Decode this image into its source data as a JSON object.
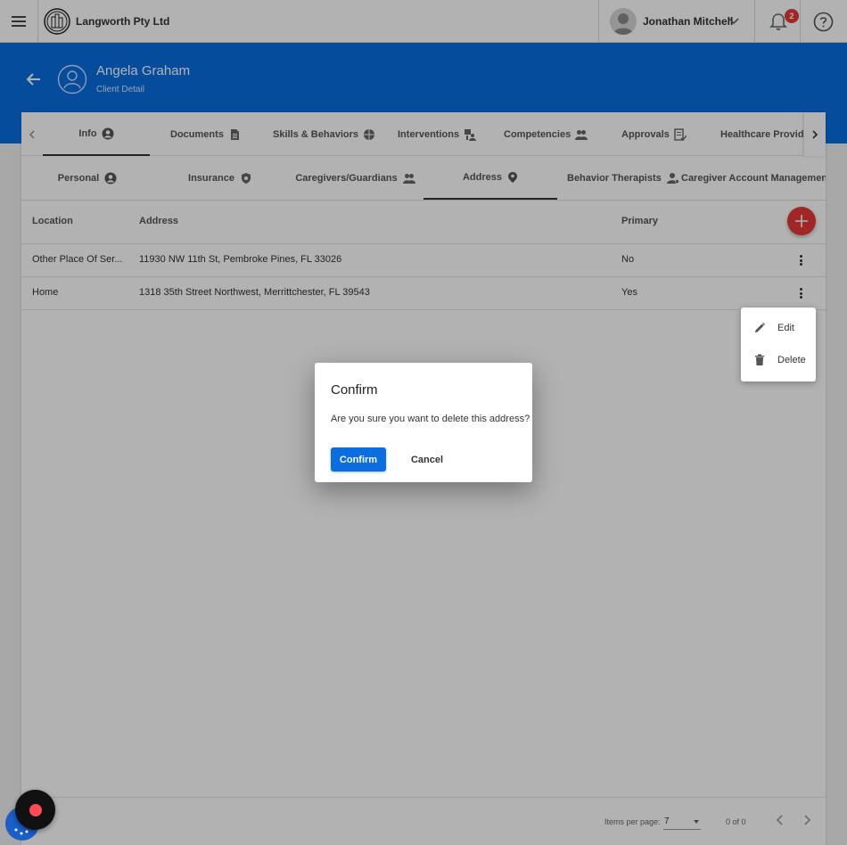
{
  "topbar": {
    "company": "Langworth Pty Ltd",
    "user_name": "Jonathan Mitchell",
    "notification_count": "2"
  },
  "header": {
    "client_name": "Angela Graham",
    "client_subtitle": "Client Detail"
  },
  "main_tabs": [
    {
      "label": "Info",
      "icon": "user-circle-icon",
      "active": true
    },
    {
      "label": "Documents",
      "icon": "document-icon",
      "active": false
    },
    {
      "label": "Skills & Behaviors",
      "icon": "skills-icon",
      "active": false
    },
    {
      "label": "Interventions",
      "icon": "interventions-icon",
      "active": false
    },
    {
      "label": "Competencies",
      "icon": "group-icon",
      "active": false
    },
    {
      "label": "Approvals",
      "icon": "approval-icon",
      "active": false
    },
    {
      "label": "Healthcare Providers",
      "icon": "",
      "active": false
    }
  ],
  "sub_tabs": [
    {
      "label": "Personal",
      "icon": "user-circle-icon",
      "active": false
    },
    {
      "label": "Insurance",
      "icon": "shield-icon",
      "active": false
    },
    {
      "label": "Caregivers/Guardians",
      "icon": "group-icon",
      "active": false
    },
    {
      "label": "Address",
      "icon": "location-pin-icon",
      "active": true
    },
    {
      "label": "Behavior Therapists",
      "icon": "person-gear-icon",
      "active": false
    },
    {
      "label": "Caregiver Account Management",
      "icon": "",
      "active": false
    }
  ],
  "table": {
    "columns": [
      "Location",
      "Address",
      "Primary"
    ],
    "rows": [
      {
        "location": "Other Place Of Ser...",
        "address": "11930 NW 11th St, Pembroke Pines, FL 33026",
        "primary": "No"
      },
      {
        "location": "Home",
        "address": "1318 35th Street Northwest, Merrittchester, FL 39543",
        "primary": "Yes"
      }
    ]
  },
  "context_menu": {
    "edit": "Edit",
    "delete": "Delete"
  },
  "dialog": {
    "title": "Confirm",
    "message": "Are you sure you want to delete this address?",
    "confirm": "Confirm",
    "cancel": "Cancel"
  },
  "pagination": {
    "items_per_page_label": "Items per page:",
    "items_per_page": "7",
    "range": "0 of 0"
  },
  "colors": {
    "primary": "#0a6de0",
    "danger": "#e53935"
  }
}
